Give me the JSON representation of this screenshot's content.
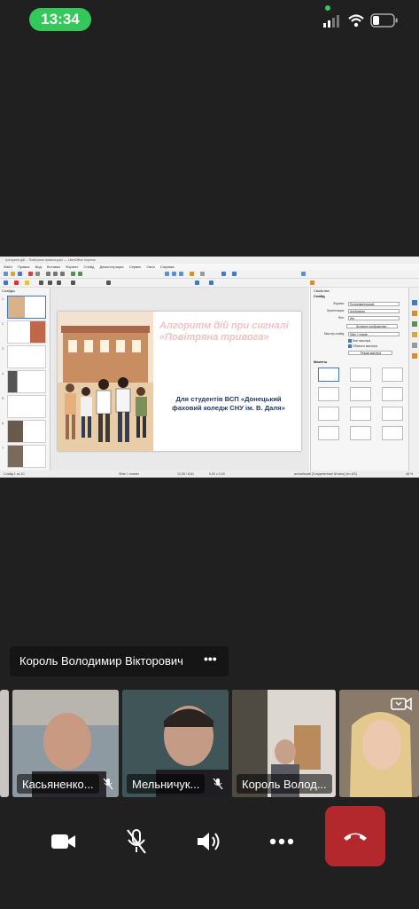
{
  "status_bar": {
    "time": "13:34"
  },
  "shared_screen": {
    "window_title": "Алгоритм дій ... Повітряна тривога.pptx — LibreOffice Impress",
    "menu": [
      "Файл",
      "Правка",
      "Вид",
      "Вставка",
      "Формат",
      "Слайд",
      "Демонстрация",
      "Сервис",
      "Окно",
      "Справка"
    ],
    "panels": {
      "slides": "Слайды",
      "properties": "Свойства",
      "slide_section": "Слайд",
      "layouts": "Макеты"
    },
    "slide": {
      "title": "Алгоритм дій при сигналі «Повітряна тривога»",
      "body": "Для студентів ВСП «Донецький фаховий коледж СНУ ім. В. Даля»"
    },
    "properties": {
      "format_label": "Формат:",
      "format_value": "Пользовательский",
      "orientation_label": "Ориентация:",
      "orientation_value": "Альбомная",
      "background_label": "Фон:",
      "background_value": "Нет",
      "insert_image": "Вставить изображение...",
      "master_label": "Мастер-слайд:",
      "master_value": "Slide 1 master",
      "master_objects": "Фон мастера",
      "master_bg": "Объекты мастера",
      "master_mode": "Режим мастера"
    },
    "status_left": "Слайд 1 из 10",
    "status_mid": "Slide 1 master",
    "status_coords": "12,55 / 8,61",
    "status_size": "0,00 x 0,00",
    "status_lang": "английский (Соединенные Штаты) (en-US)",
    "status_zoom": "48 %",
    "thumb_numbers": [
      "1",
      "2",
      "3",
      "4",
      "5",
      "6",
      "7"
    ]
  },
  "speaker": {
    "name": "Король Володимир Вікторович"
  },
  "participants": [
    {
      "name": "Касьяненко..."
    },
    {
      "name": "Мельничук..."
    },
    {
      "name": "Король Волод..."
    }
  ],
  "colors": {
    "time_pill": "#34c759",
    "hangup": "#b3282d",
    "slide_title": "#f0c2c2",
    "slide_body": "#233a66"
  },
  "icons": {
    "signal": "cellular-signal-icon",
    "wifi": "wifi-icon",
    "battery": "battery-icon",
    "camera": "video-camera-icon",
    "mic": "microphone-muted-icon",
    "speaker": "speaker-icon",
    "more": "more-dots-icon",
    "hangup": "phone-hangup-icon",
    "switch_camera": "switch-camera-icon"
  }
}
